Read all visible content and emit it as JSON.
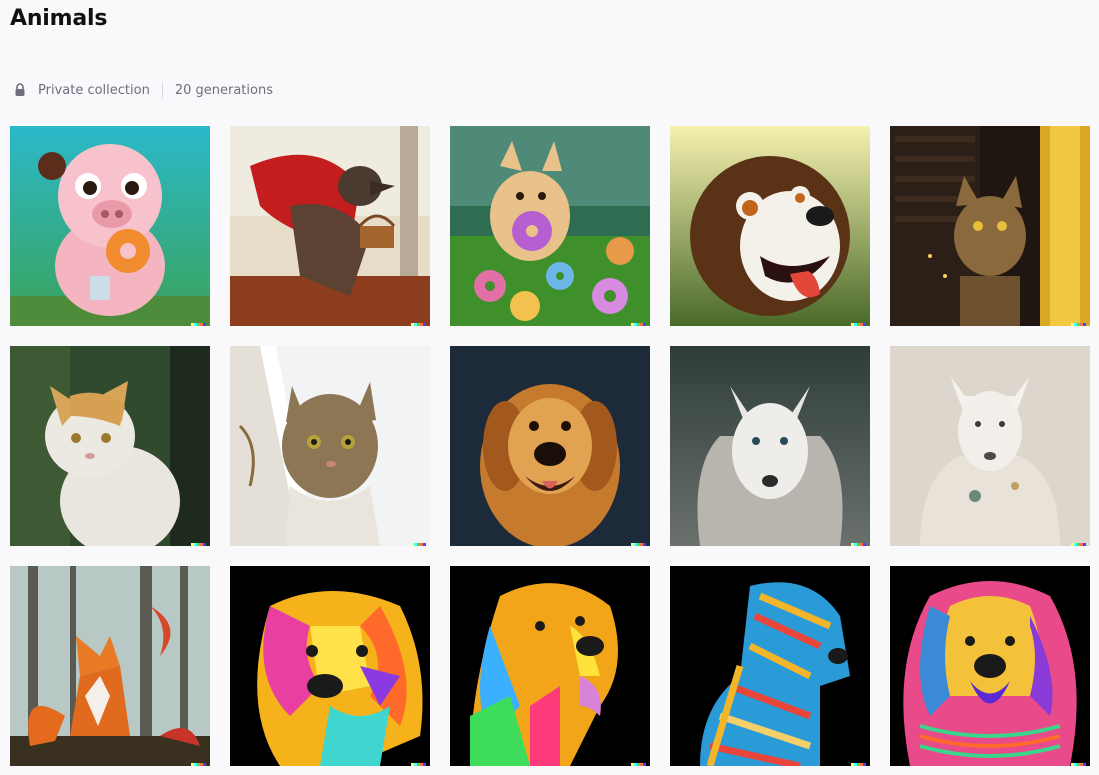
{
  "collection": {
    "title": "Animals",
    "privacy": "Private collection",
    "count": "20 generations"
  },
  "icons": {
    "lock": "lock-icon",
    "signature": "dalle-signature-mark"
  },
  "images": [
    {
      "subject": "pig-with-donuts"
    },
    {
      "subject": "wolf-red-cape-basket"
    },
    {
      "subject": "fox-donuts-in-grass"
    },
    {
      "subject": "cartoon-dog-tongue"
    },
    {
      "subject": "cat-at-window-night"
    },
    {
      "subject": "white-orange-cat"
    },
    {
      "subject": "tabby-cat-peeking"
    },
    {
      "subject": "golden-retriever-portrait"
    },
    {
      "subject": "white-wolf-fur"
    },
    {
      "subject": "white-wolf-robe"
    },
    {
      "subject": "fox-in-forest"
    },
    {
      "subject": "colorful-retriever-1"
    },
    {
      "subject": "colorful-retriever-2"
    },
    {
      "subject": "colorful-retriever-3"
    },
    {
      "subject": "colorful-retriever-4"
    }
  ]
}
